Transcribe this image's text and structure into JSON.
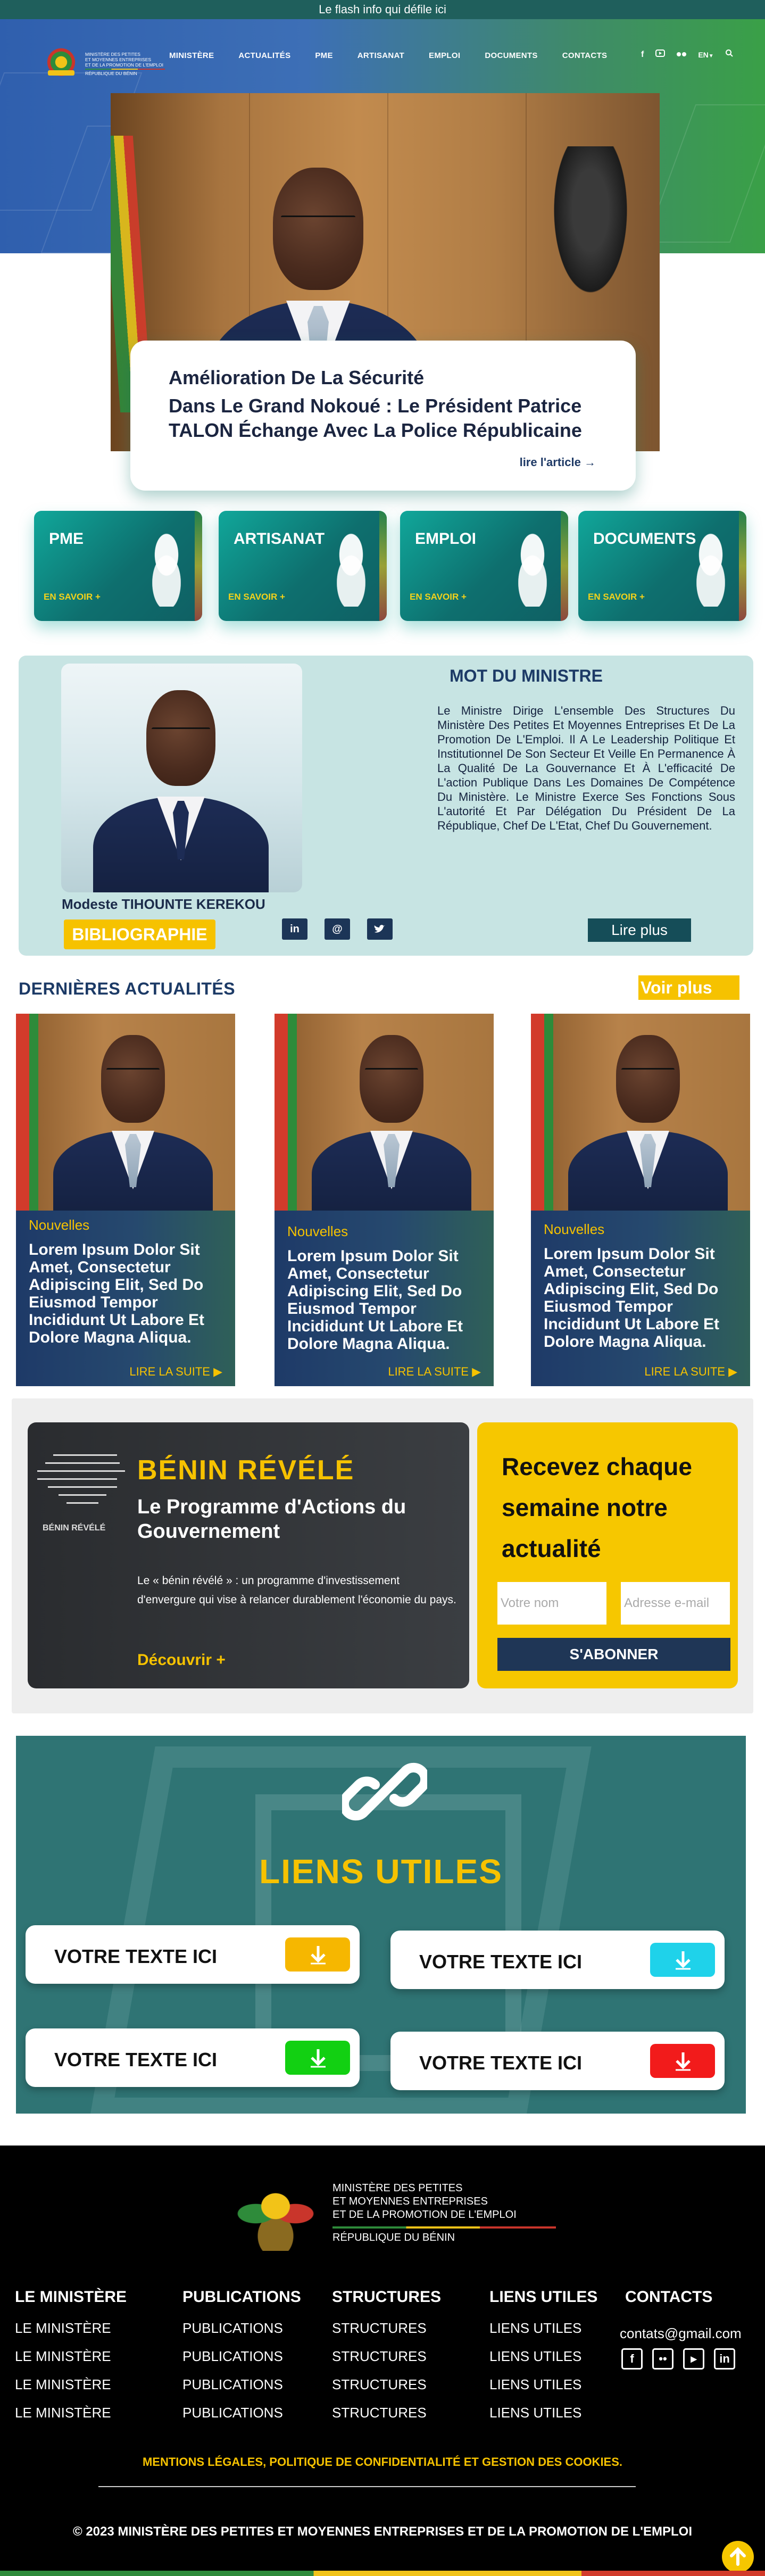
{
  "flash": "Le flash info qui défile ici",
  "header": {
    "logo_lines": [
      "Ministère des Petites",
      "et Moyennes Entreprises",
      "et de la Promotion de l'Emploi",
      "République du Bénin"
    ],
    "nav": [
      "MINISTÈRE",
      "ACTUALITÉS",
      "PME",
      "ARTISANAT",
      "EMPLOI",
      "DOCUMENTS",
      "CONTACTS"
    ],
    "social_icons": [
      "facebook-icon",
      "youtube-icon",
      "flickr-icon"
    ],
    "language": "EN",
    "search_icon": "search-icon"
  },
  "hero": {
    "line1": "Amélioration De La Sécurité",
    "line2": "Dans Le Grand Nokoué : Le Président Patrice TALON Échange Avec La Police Républicaine",
    "cta": "lire l'article"
  },
  "categories": [
    {
      "title": "PME",
      "link": "EN SAVOIR +"
    },
    {
      "title": "ARTISANAT",
      "link": "EN SAVOIR +"
    },
    {
      "title": "EMPLOI",
      "link": "EN SAVOIR +"
    },
    {
      "title": "DOCUMENTS",
      "link": "EN SAVOIR +"
    }
  ],
  "minister": {
    "name": "Modeste TIHOUNTE KEREKOU",
    "bio_button": "BIBLIOGRAPHIE",
    "social": [
      "in",
      "@",
      "twitter"
    ],
    "section_title": "MOT DU MINISTRE",
    "text": "Le Ministre Dirige L'ensemble Des Structures Du Ministère Des Petites Et Moyennes Entreprises Et De La Promotion De L'Emploi. Il A Le Leadership Politique Et Institutionnel De Son Secteur Et Veille En Permanence À La Qualité De La Gouvernance Et À L'efficacité De L'action Publique Dans Les Domaines De Compétence Du Ministère. Le Ministre Exerce Ses Fonctions Sous L'autorité Et Par Délégation Du Président De La République, Chef De L'Etat, Chef Du Gouvernement.",
    "more": "Lire plus"
  },
  "news": {
    "title": "DERNIÈRES ACTUALITÉS",
    "see_more": "Voir plus",
    "items": [
      {
        "tag": "Nouvelles",
        "text": "Lorem Ipsum Dolor Sit Amet, Consectetur Adipiscing Elit, Sed Do Eiusmod Tempor Incididunt Ut Labore Et Dolore Magna Aliqua.",
        "more": "LIRE LA SUITE"
      },
      {
        "tag": "Nouvelles",
        "text": "Lorem Ipsum Dolor Sit Amet, Consectetur Adipiscing Elit, Sed Do Eiusmod Tempor Incididunt Ut Labore Et Dolore Magna Aliqua.",
        "more": "LIRE LA SUITE"
      },
      {
        "tag": "Nouvelles",
        "text": "Lorem Ipsum Dolor Sit Amet, Consectetur Adipiscing Elit, Sed Do Eiusmod Tempor Incididunt Ut Labore Et Dolore Magna Aliqua.",
        "more": "LIRE LA SUITE"
      }
    ]
  },
  "benin_revele": {
    "map_label": "BÉNIN RÉVÉLÉ",
    "title": "BÉNIN RÉVÉLÉ",
    "subtitle": "Le Programme d'Actions du Gouvernement",
    "text": "Le « bénin révélé » : un programme d'investissement d'envergure qui vise à relancer durablement l'économie du pays.",
    "cta": "Découvrir +"
  },
  "newsletter": {
    "title": "Recevez chaque semaine notre actualité",
    "name_placeholder": "Votre nom",
    "email_placeholder": "Adresse e-mail",
    "button": "S'ABONNER"
  },
  "useful_links": {
    "title": "LIENS UTILES",
    "items": [
      {
        "label": "VOTRE TEXTE ICI",
        "color": "#f6b700"
      },
      {
        "label": "VOTRE TEXTE ICI",
        "color": "#1fd2ea"
      },
      {
        "label": "VOTRE TEXTE ICI",
        "color": "#12d012"
      },
      {
        "label": "VOTRE TEXTE ICI",
        "color": "#f21b1b"
      }
    ]
  },
  "footer": {
    "logo_lines": [
      "Ministère des Petites",
      "et Moyennes Entreprises",
      "et de la Promotion de l'Emploi"
    ],
    "republic": "République du Bénin",
    "columns": [
      {
        "title": "LE MINISTÈRE",
        "items": [
          "LE MINISTÈRE",
          "LE MINISTÈRE",
          "LE MINISTÈRE",
          "LE MINISTÈRE"
        ]
      },
      {
        "title": "PUBLICATIONS",
        "items": [
          "PUBLICATIONS",
          "PUBLICATIONS",
          "PUBLICATIONS",
          "PUBLICATIONS"
        ]
      },
      {
        "title": "STRUCTURES",
        "items": [
          "STRUCTURES",
          "STRUCTURES",
          "STRUCTURES",
          "STRUCTURES"
        ]
      },
      {
        "title": "LIENS UTILES",
        "items": [
          "LIENS UTILES",
          "LIENS UTILES",
          "LIENS UTILES",
          "LIENS UTILES"
        ]
      }
    ],
    "contacts_title": "CONTACTS",
    "email": "contats@gmail.com",
    "legal": "MENTIONS LÉGALES, POLITIQUE DE CONFIDENTIALITÉ ET GESTION DES COOKIES.",
    "copyright": "© 2023 MINISTÈRE DES PETITES ET MOYENNES ENTREPRISES ET DE LA PROMOTION DE L'EMPLOI"
  },
  "colors": {
    "accent_yellow": "#f6c200",
    "teal": "#1f5f5c",
    "navy": "#1c3a66"
  }
}
